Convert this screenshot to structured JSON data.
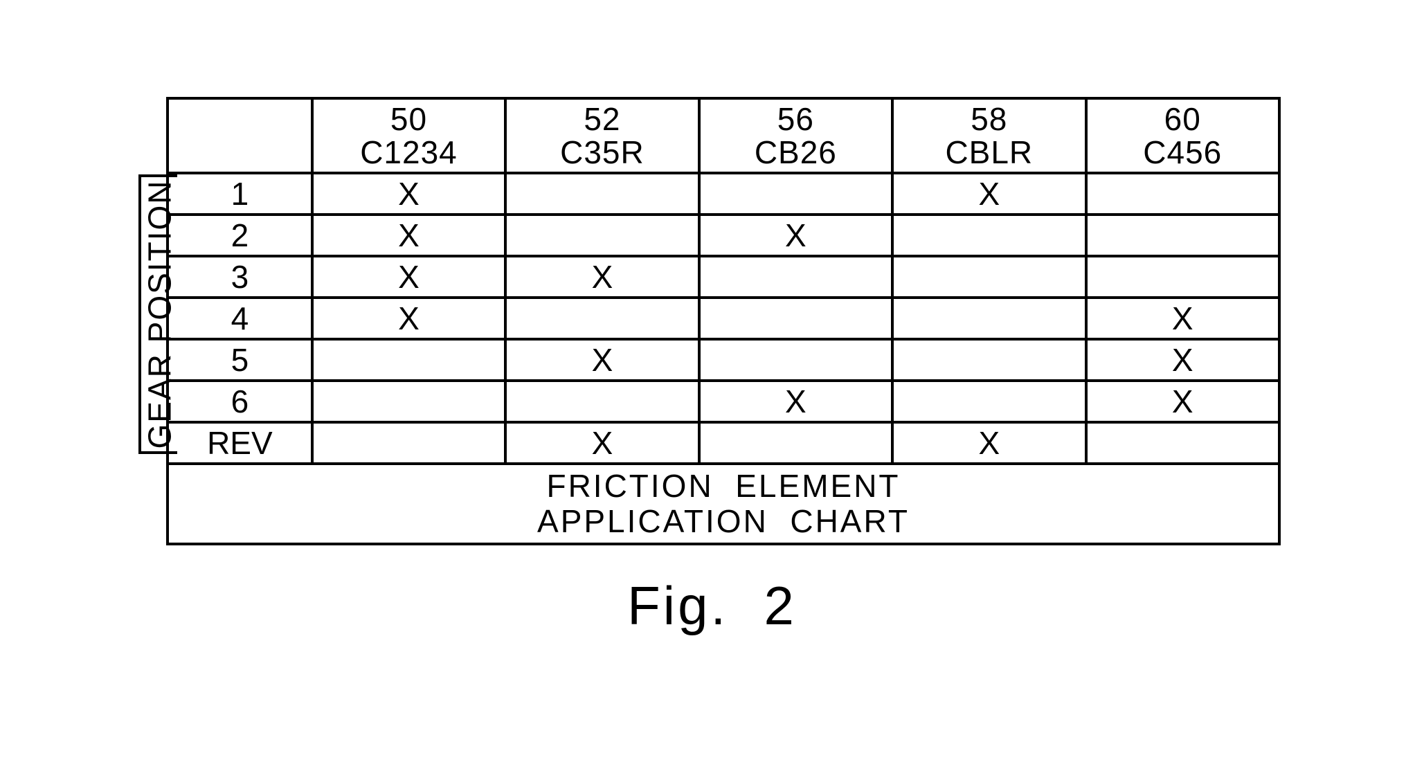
{
  "figure_caption": "Fig.  2",
  "side_label": "GEAR POSITION",
  "title_line1": "FRICTION  ELEMENT",
  "title_line2": "APPLICATION  CHART",
  "columns": [
    {
      "num": "50",
      "code": "C1234"
    },
    {
      "num": "52",
      "code": "C35R"
    },
    {
      "num": "56",
      "code": "CB26"
    },
    {
      "num": "58",
      "code": "CBLR"
    },
    {
      "num": "60",
      "code": "C456"
    }
  ],
  "rows": [
    {
      "label": "1",
      "marks": [
        "X",
        "",
        "",
        "X",
        ""
      ]
    },
    {
      "label": "2",
      "marks": [
        "X",
        "",
        "X",
        "",
        ""
      ]
    },
    {
      "label": "3",
      "marks": [
        "X",
        "X",
        "",
        "",
        ""
      ]
    },
    {
      "label": "4",
      "marks": [
        "X",
        "",
        "",
        "",
        "X"
      ]
    },
    {
      "label": "5",
      "marks": [
        "",
        "X",
        "",
        "",
        "X"
      ]
    },
    {
      "label": "6",
      "marks": [
        "",
        "",
        "X",
        "",
        "X"
      ]
    },
    {
      "label": "REV",
      "marks": [
        "",
        "X",
        "",
        "X",
        ""
      ]
    }
  ],
  "chart_data": {
    "type": "table",
    "title": "FRICTION ELEMENT APPLICATION CHART",
    "row_axis": "GEAR POSITION",
    "columns": [
      {
        "id": 50,
        "name": "C1234"
      },
      {
        "id": 52,
        "name": "C35R"
      },
      {
        "id": 56,
        "name": "CB26"
      },
      {
        "id": 58,
        "name": "CBLR"
      },
      {
        "id": 60,
        "name": "C456"
      }
    ],
    "rows": [
      "1",
      "2",
      "3",
      "4",
      "5",
      "6",
      "REV"
    ],
    "matrix": [
      [
        true,
        false,
        false,
        true,
        false
      ],
      [
        true,
        false,
        true,
        false,
        false
      ],
      [
        true,
        true,
        false,
        false,
        false
      ],
      [
        true,
        false,
        false,
        false,
        true
      ],
      [
        false,
        true,
        false,
        false,
        true
      ],
      [
        false,
        false,
        true,
        false,
        true
      ],
      [
        false,
        true,
        false,
        true,
        false
      ]
    ]
  }
}
